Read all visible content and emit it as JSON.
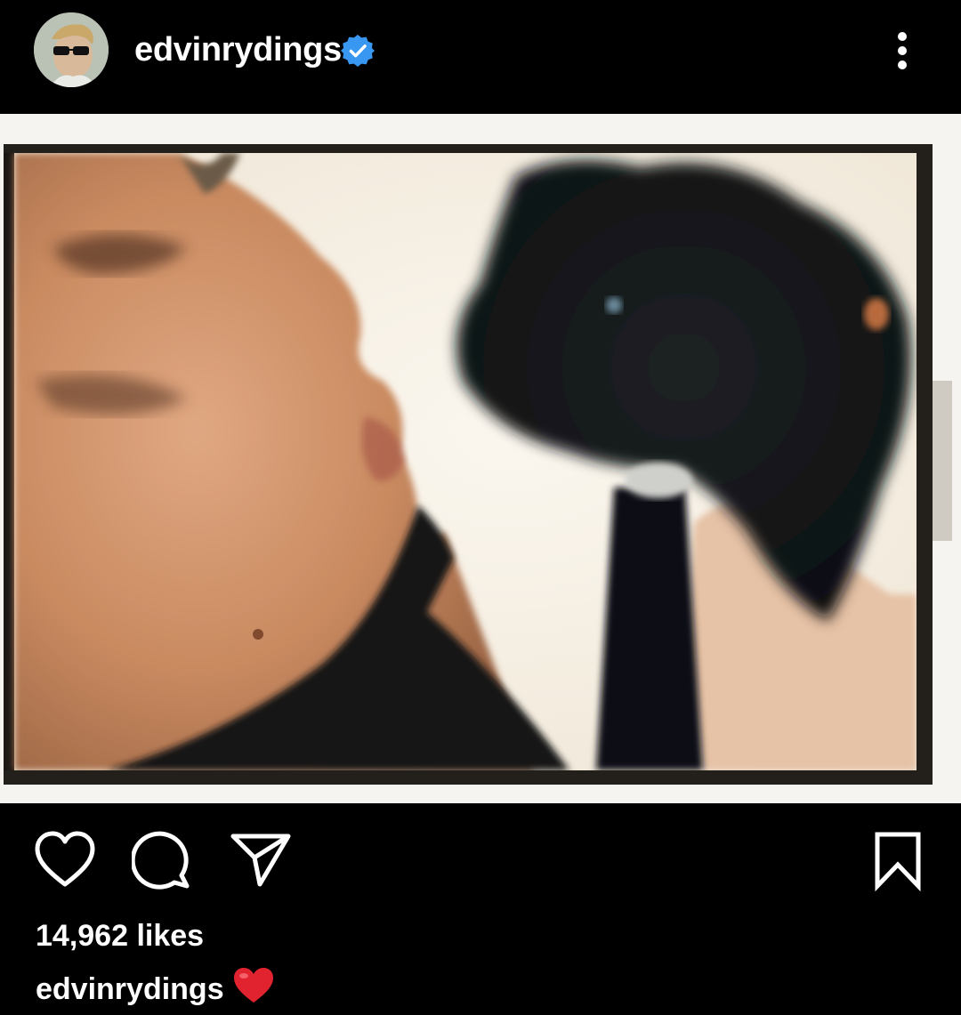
{
  "post": {
    "username": "edvinrydings",
    "verified": true,
    "likes_text": "14,962 likes",
    "caption_username": "edvinrydings",
    "caption_emoji": "red-heart-emoji"
  },
  "icons": {
    "avatar": "profile-photo",
    "verified": "verified-badge-icon",
    "more": "more-vertical-icon",
    "like": "heart-outline-icon",
    "comment": "comment-bubble-icon",
    "share": "paper-plane-icon",
    "save": "bookmark-outline-icon"
  },
  "colors": {
    "background": "#000000",
    "text": "#ffffff",
    "verified_blue": "#3897f0",
    "heart_red": "#ed4956"
  }
}
